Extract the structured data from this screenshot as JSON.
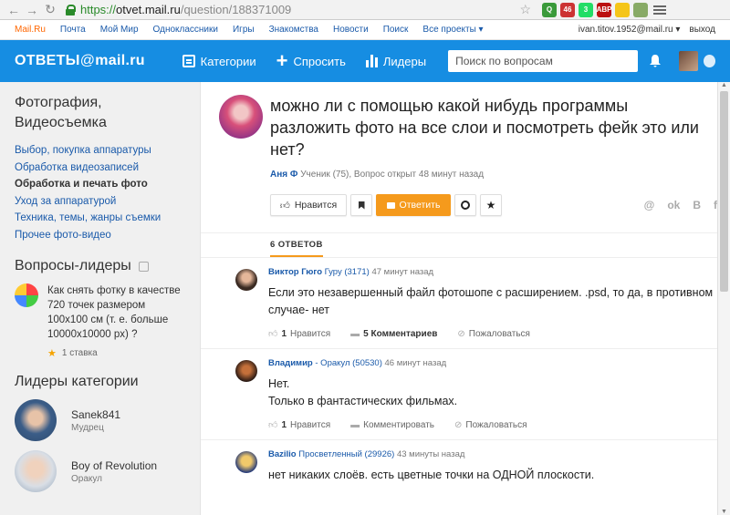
{
  "browser": {
    "url_scheme": "https://",
    "url_host": "otvet.mail.ru",
    "url_path": "/question/188371009",
    "ext_badges": [
      "46",
      "3",
      "ABP",
      ""
    ]
  },
  "portal": {
    "links": [
      "Mail.Ru",
      "Почта",
      "Мой Мир",
      "Одноклассники",
      "Игры",
      "Знакомства",
      "Новости",
      "Поиск",
      "Все проекты ▾"
    ],
    "user": "ivan.titov.1952@mail.ru ▾",
    "exit": "выход"
  },
  "header": {
    "logo_left": "ОТВЕТЫ",
    "logo_at": "@",
    "logo_right": "mail.ru",
    "nav": [
      "Категории",
      "Спросить",
      "Лидеры"
    ],
    "search_placeholder": "Поиск по вопросам"
  },
  "sidebar": {
    "category_title": "Фотография, Видеосъемка",
    "links": [
      {
        "label": "Выбор, покупка аппаратуры",
        "active": false
      },
      {
        "label": "Обработка видеозаписей",
        "active": false
      },
      {
        "label": "Обработка и печать фото",
        "active": true
      },
      {
        "label": "Уход за аппаратурой",
        "active": false
      },
      {
        "label": "Техника, темы, жанры съемки",
        "active": false
      },
      {
        "label": "Прочее фото-видео",
        "active": false
      }
    ],
    "leaders_q_title": "Вопросы-лидеры",
    "leader_question": "Как снять фотку в качестве 720 точек размером 100х100 см (т. е. больше 10000х10000 px) ?",
    "leader_question_stat": "1 ставка",
    "category_leaders_title": "Лидеры категории",
    "category_leaders": [
      {
        "name": "Sanek841",
        "rank": "Мудрец"
      },
      {
        "name": "Boy of Revolution",
        "rank": "Оракул"
      }
    ]
  },
  "question": {
    "title": "можно ли с помощью какой нибудь программы разложить фото на все слои и посмотреть фейк это или нет?",
    "author": "Аня Ф",
    "meta": "Ученик (75), Вопрос открыт 48 минут назад",
    "like_label": "Нравится",
    "answer_label": "Ответить",
    "social": [
      "@",
      "ok",
      "B",
      "f"
    ]
  },
  "answers": {
    "count_label": "6 ОТВЕТОВ",
    "items": [
      {
        "name": "Виктор Гюго",
        "rank": "Гуру (3171)",
        "time": "47 минут назад",
        "text": "Если это незавершенный файл фотошопе с расширением. .psd, то да, в противном случае- нет",
        "likes": "1",
        "like_label": "Нравится",
        "comments": "5 Комментариев",
        "report": "Пожаловаться"
      },
      {
        "name": "Владимир",
        "rank": "- Оракул (50530)",
        "time": "46 минут назад",
        "text": "Нет.\nТолько в фантастических фильмах.",
        "likes": "1",
        "like_label": "Нравится",
        "comments": "Комментировать",
        "report": "Пожаловаться"
      },
      {
        "name": "Bazilio",
        "rank": "Просветленный (29926)",
        "time": "43 минуты назад",
        "text": "нет никаких слоёв. есть цветные точки на ОДНОЙ плоскости.",
        "likes": "",
        "like_label": "",
        "comments": "",
        "report": ""
      }
    ]
  }
}
